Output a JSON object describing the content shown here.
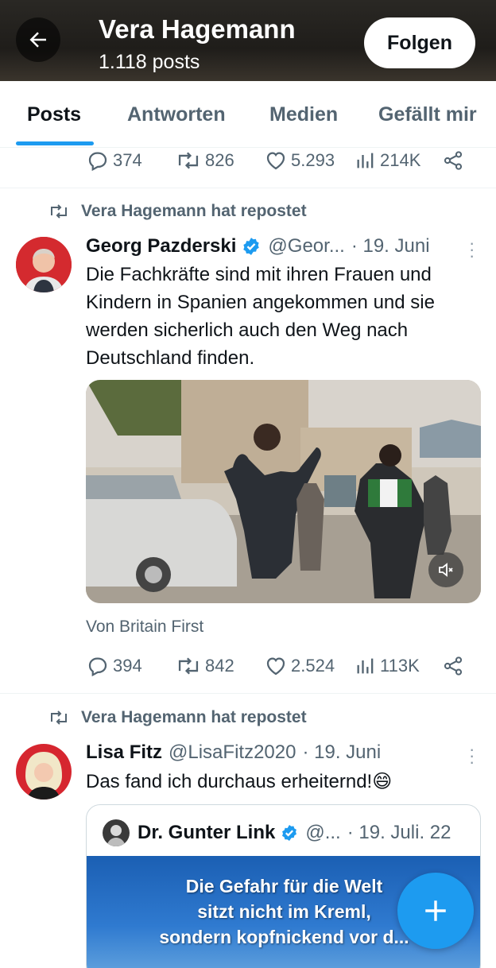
{
  "header": {
    "title": "Vera Hagemann",
    "subtitle": "1.118 posts",
    "follow_label": "Folgen"
  },
  "tabs": [
    {
      "label": "Posts",
      "active": true
    },
    {
      "label": "Antworten",
      "active": false
    },
    {
      "label": "Medien",
      "active": false
    },
    {
      "label": "Gefällt mir",
      "active": false
    }
  ],
  "accent_color": "#1d9bf0",
  "top_actions": {
    "replies": "374",
    "reposts": "826",
    "likes": "5.293",
    "views": "214K"
  },
  "posts": [
    {
      "repost_label": "Vera Hagemann hat repostet",
      "author": "Georg Pazderski",
      "verified": true,
      "handle": "@Geor...",
      "date": "· 19. Juni",
      "text": "Die Fachkräfte sind mit ihren Frauen und Kindern in Spanien angekommen und sie werden sicherlich auch den Weg nach Deutschland finden.",
      "media_type": "video",
      "source": "Von Britain First",
      "actions": {
        "replies": "394",
        "reposts": "842",
        "likes": "2.524",
        "views": "113K"
      }
    },
    {
      "repost_label": "Vera Hagemann hat repostet",
      "author": "Lisa Fitz",
      "handle": "@LisaFitz2020",
      "date": "· 19. Juni",
      "text": "Das fand ich durchaus erheiternd!😄",
      "quote": {
        "author": "Dr. Gunter Link",
        "verified": true,
        "handle": "@...",
        "date": "· 19. Juli. 22",
        "image_caption": "Die Gefahr für die Welt\nsitzt nicht im Kreml,\nsondern kopfnickend vor d..."
      }
    }
  ],
  "icons": {
    "back": "arrow-left-icon",
    "reply": "reply-icon",
    "repost": "repost-icon",
    "like": "heart-icon",
    "views": "views-icon",
    "share": "share-icon",
    "verified": "verified-badge-icon",
    "mute": "mute-icon",
    "compose": "plus-icon"
  }
}
